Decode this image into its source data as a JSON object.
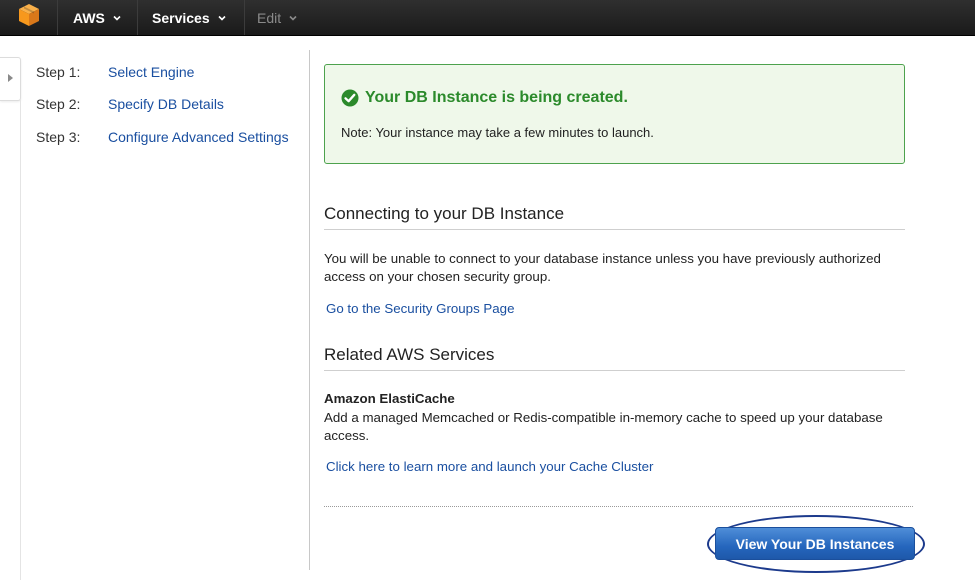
{
  "topbar": {
    "logo_icon": "aws-cube-icon",
    "nav": [
      {
        "label": "AWS",
        "icon": "chevron-down-icon"
      },
      {
        "label": "Services",
        "icon": "chevron-down-icon"
      },
      {
        "label": "Edit",
        "icon": "chevron-down-icon"
      }
    ]
  },
  "sidebar": {
    "toggle_icon": "caret-right-icon"
  },
  "steps": [
    {
      "num": "Step 1:",
      "label": "Select Engine"
    },
    {
      "num": "Step 2:",
      "label": "Specify DB Details"
    },
    {
      "num": "Step 3:",
      "label": "Configure Advanced Settings"
    }
  ],
  "success": {
    "icon": "check-circle-icon",
    "title": "Your DB Instance is being created.",
    "note": "Note: Your instance may take a few minutes to launch."
  },
  "connecting": {
    "heading": "Connecting to your DB Instance",
    "body": "You will be unable to connect to your database instance unless you have previously authorized access on your chosen security group.",
    "link": "Go to the Security Groups Page"
  },
  "related": {
    "heading": "Related AWS Services",
    "title": "Amazon ElastiCache",
    "body": "Add a managed Memcached or Redis-compatible in-memory cache to speed up your database access.",
    "link": "Click here to learn more and launch your Cache Cluster"
  },
  "cta": {
    "label": "View Your DB Instances"
  },
  "colors": {
    "topbar": "#232323",
    "link": "#1a4fa0",
    "success_text": "#2b8a2b",
    "success_border": "#4da24d",
    "button": "#2566bd",
    "aws_orange": "#f7981d"
  }
}
